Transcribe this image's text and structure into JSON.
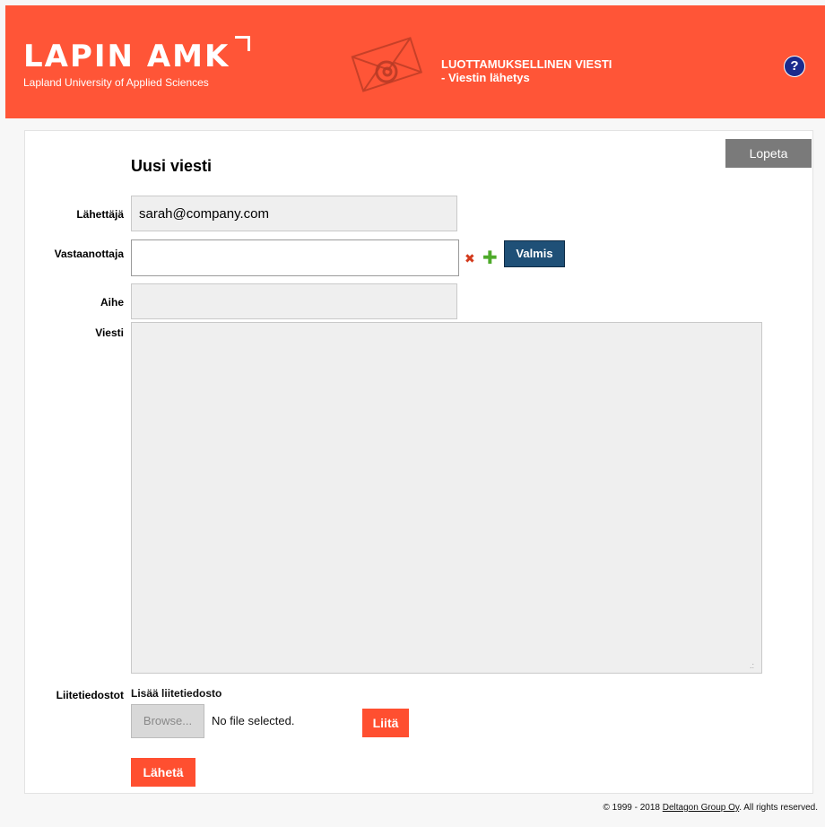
{
  "header": {
    "logo_title": "LAPIN AMK",
    "logo_subtitle": "Lapland University of Applied Sciences",
    "title_line1": "LUOTTAMUKSELLINEN VIESTI",
    "title_line2": "- Viestin lähetys",
    "help_label": "?"
  },
  "toolbar": {
    "quit_label": "Lopeta"
  },
  "form": {
    "title": "Uusi viesti",
    "sender_label": "Lähettäjä",
    "sender_value": "sarah@company.com",
    "recipient_label": "Vastaanottaja",
    "recipient_value": "",
    "remove_symbol": "✖",
    "add_symbol": "✚",
    "done_label": "Valmis",
    "subject_label": "Aihe",
    "subject_value": "",
    "message_label": "Viesti",
    "message_value": ""
  },
  "attachments": {
    "label": "Liitetiedostot",
    "add_label": "Lisää liitetiedosto",
    "browse_label": "Browse...",
    "file_status": "No file selected.",
    "attach_label": "Liitä"
  },
  "actions": {
    "send_label": "Lähetä"
  },
  "footer": {
    "prefix": "© 1999 - 2018 ",
    "company": "Deltagon Group Oy",
    "suffix": ". All rights reserved."
  },
  "colors": {
    "header_bg": "#ff5537",
    "accent_orange": "#ff4f30",
    "button_blue": "#1f5077",
    "quit_gray": "#7a7a7a"
  }
}
